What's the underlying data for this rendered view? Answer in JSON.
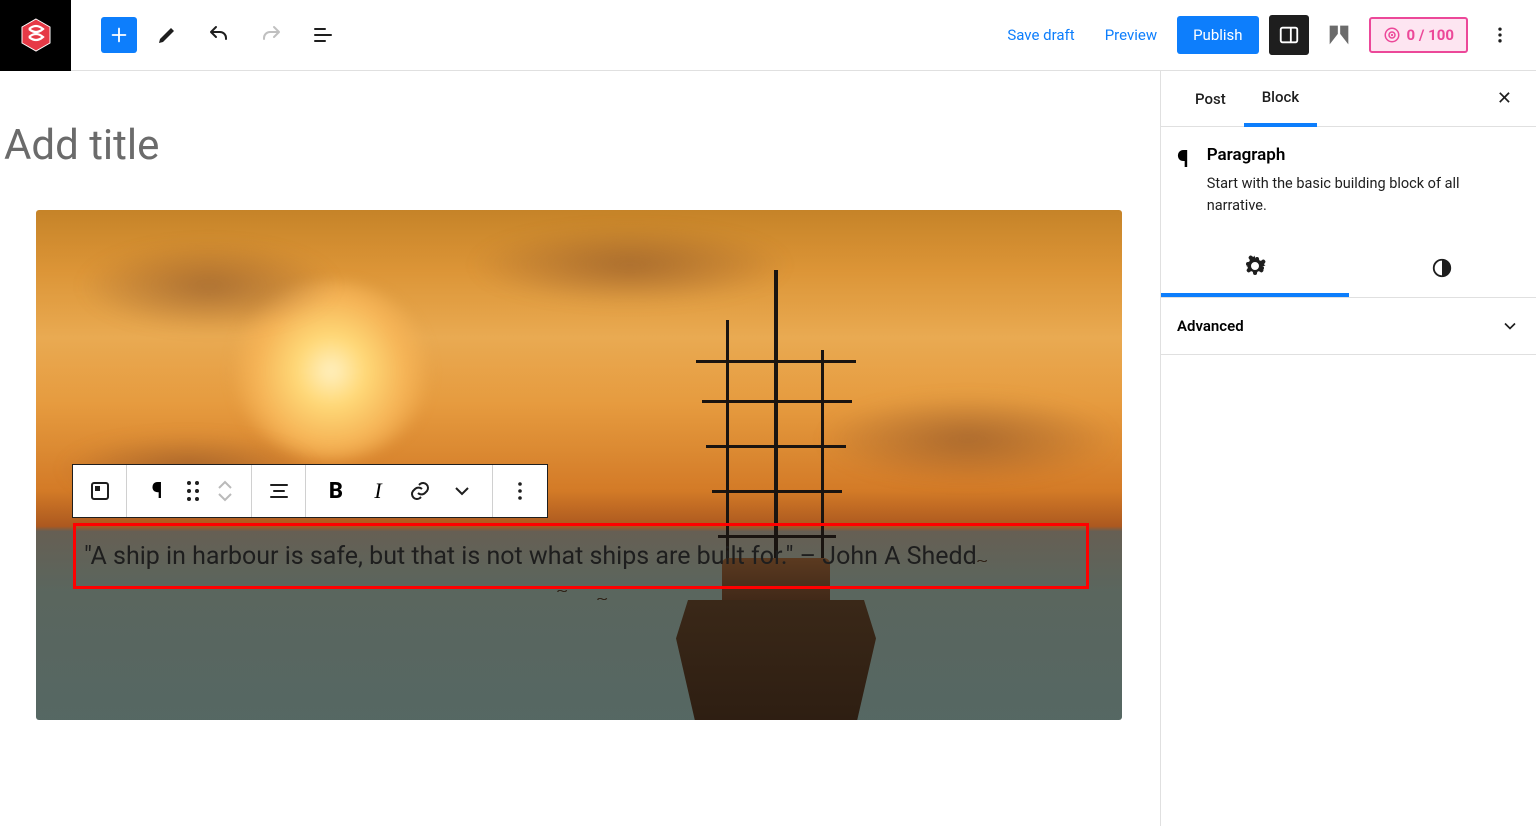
{
  "topbar": {
    "save_draft": "Save draft",
    "preview": "Preview",
    "publish": "Publish",
    "score": "0 / 100"
  },
  "editor": {
    "title_placeholder": "Add title",
    "paragraph_text": "\"A ship in harbour is safe, but that is not what ships are built for.\" – John A Shedd"
  },
  "block_toolbar": {
    "bold": "B",
    "italic": "I"
  },
  "sidebar": {
    "tabs": {
      "post": "Post",
      "block": "Block"
    },
    "block": {
      "name": "Paragraph",
      "description": "Start with the basic building block of all narrative."
    },
    "panels": {
      "advanced": "Advanced"
    }
  }
}
